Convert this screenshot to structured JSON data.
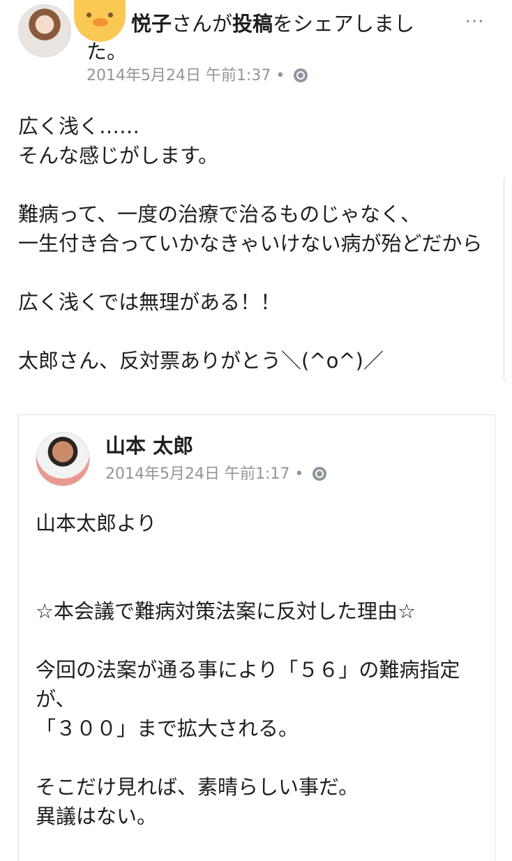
{
  "post": {
    "share_line_name": "悦子",
    "share_line_san": "さんが",
    "share_line_verb": "投稿",
    "share_line_rest": "をシェアしました。",
    "date": "2014年5月24日 午前1:37",
    "separator": "•",
    "privacy_icon": "globe-icon",
    "more_icon": "…",
    "body": [
      "広く浅く……",
      "そんな感じがします。",
      "",
      "難病って、一度の治療で治るものじゃなく、",
      "一生付き合っていかなきゃいけない病が殆どだから",
      "",
      "広く浅くでは無理がある！！",
      "",
      "太郎さん、反対票ありがとう＼(^o^)／"
    ]
  },
  "shared": {
    "author": "山本 太郎",
    "date": "2014年5月24日 午前1:17",
    "separator": "•",
    "privacy_icon": "globe-icon",
    "body": [
      "山本太郎より",
      "",
      "",
      "☆本会議で難病対策法案に反対した理由☆",
      "",
      "今回の法案が通る事により「５６」の難病指定が、",
      "「３００」まで拡大される。",
      "",
      "そこだけ見れば、素晴らしい事だ。",
      "異議はない。"
    ]
  }
}
